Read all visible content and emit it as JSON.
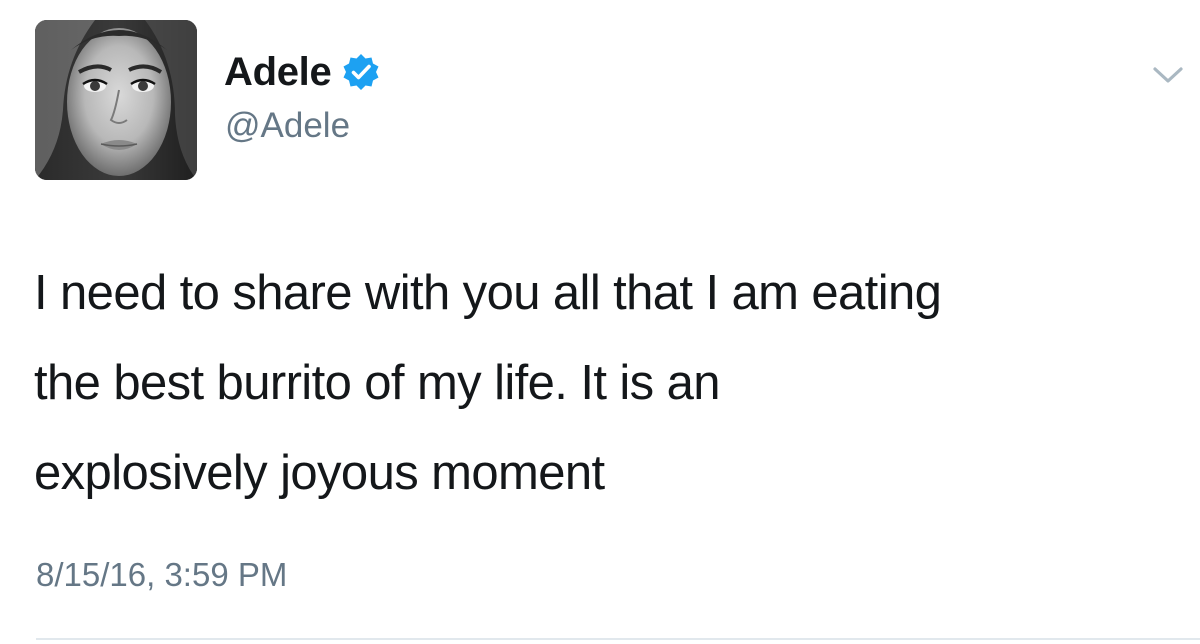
{
  "author": {
    "name": "Adele",
    "handle": "@Adele",
    "verified": true,
    "verified_color": "#1da1f2"
  },
  "tweet": {
    "text_lines": [
      "I need to share with you all that I am eating",
      "the best burrito of my life. It is an",
      "explosively joyous moment"
    ],
    "timestamp": "8/15/16, 3:59 PM"
  },
  "icons": {
    "verified": "verified-badge-icon",
    "menu": "chevron-down-icon"
  },
  "colors": {
    "text": "#14171a",
    "secondary": "#657786",
    "divider": "#e1e8ed"
  }
}
